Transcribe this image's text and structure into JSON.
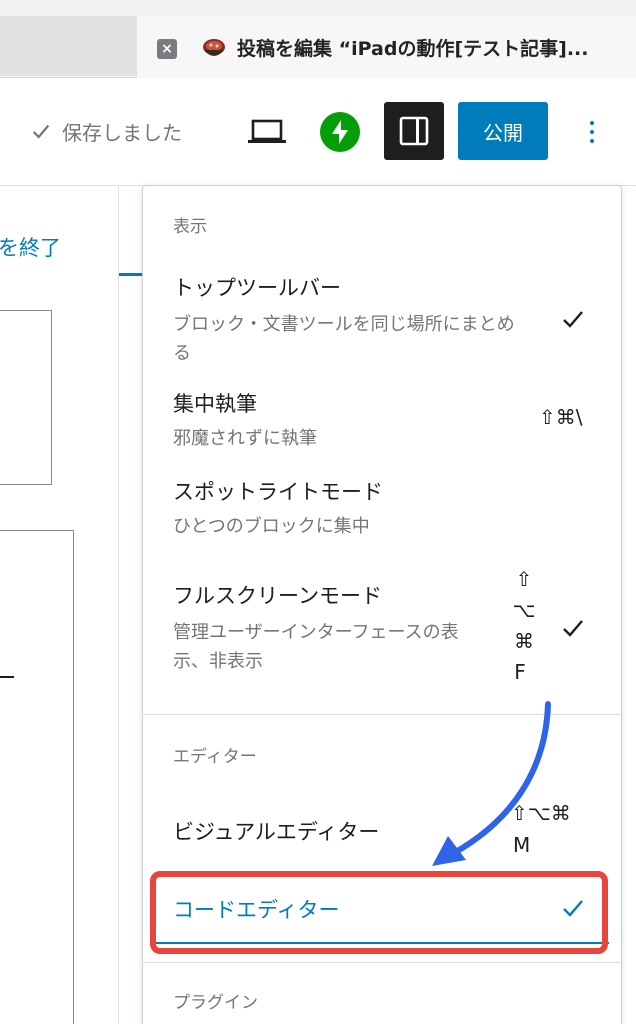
{
  "browser": {
    "tab_close_glyph": "×",
    "tab_title": "投稿を編集 “iPadの動作[テスト記事]..."
  },
  "toolbar": {
    "saved_label": "保存しました",
    "publish_label": "公開"
  },
  "background": {
    "exit_link": "を終了"
  },
  "menu": {
    "view": {
      "label": "表示",
      "items": [
        {
          "title": "トップツールバー",
          "desc": "ブロック・文書ツールを同じ場所にまとめる",
          "checked": true
        },
        {
          "title": "集中執筆",
          "desc": "邪魔されずに執筆",
          "shortcut": "⇧⌘\\"
        },
        {
          "title": "スポットライトモード",
          "desc": "ひとつのブロックに集中"
        },
        {
          "title": "フルスクリーンモード",
          "desc": "管理ユーザーインターフェースの表示、非表示",
          "shortcut": [
            "⇧",
            "⌥",
            "⌘",
            "F"
          ],
          "checked": true
        }
      ]
    },
    "editor": {
      "label": "エディター",
      "items": [
        {
          "title": "ビジュアルエディター",
          "shortcut_line1": "⇧⌥⌘",
          "shortcut_line2": "M"
        },
        {
          "title": "コードエディター",
          "checked": true
        }
      ]
    },
    "plugins": {
      "label": "プラグイン"
    }
  },
  "colors": {
    "accent": "#007cba",
    "highlight": "#e8453c",
    "arrow": "#2f63e8",
    "jetpack": "#069e08"
  },
  "icons": [
    "close-icon",
    "favicon-icon",
    "checkmark-icon",
    "desktop-preview-icon",
    "jetpack-icon",
    "sidebar-settings-icon",
    "more-vertical-icon"
  ]
}
